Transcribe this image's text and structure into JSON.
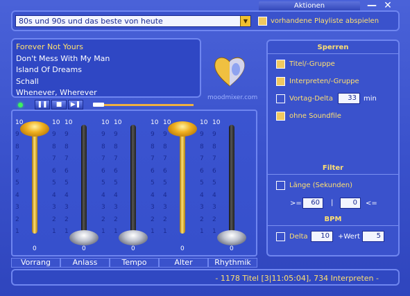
{
  "header": {
    "menu_label": "Aktionen",
    "minimize_label": "—",
    "close_label": "✕"
  },
  "playlist_selector": {
    "value": "80s und 90s und das beste von heute",
    "checkbox_label": "vorhandene Playliste abspielen"
  },
  "tracks": [
    "Forever Not Yours",
    "Don't Mess With My Man",
    "Island Of Dreams",
    "Schall",
    "Whenever, Wherever"
  ],
  "logo_text": "moodmixer.com",
  "transport": {
    "play_label": "▶",
    "pause_label": "❚❚",
    "stop_label": "■",
    "next_label": "▶❚"
  },
  "sliders": {
    "scale": [
      "10",
      "9",
      "8",
      "7",
      "6",
      "5",
      "4",
      "3",
      "2",
      "1"
    ],
    "channels": [
      {
        "name": "Vorrang",
        "value": "0",
        "level": 1.0
      },
      {
        "name": "Anlass",
        "value": "0",
        "level": 0.0
      },
      {
        "name": "Tempo",
        "value": "0",
        "level": 0.0
      },
      {
        "name": "Alter",
        "value": "0",
        "level": 1.0
      },
      {
        "name": "Rhythmik",
        "value": "0",
        "level": 0.0
      }
    ]
  },
  "sperren": {
    "title": "Sperren",
    "titel_gruppe": "Titel/-Gruppe",
    "interpreten_gruppe": "Interpreten/-Gruppe",
    "vortag_delta": "Vortag-Delta",
    "vortag_value": "33",
    "vortag_unit": "min",
    "ohne_soundfile": "ohne Soundfile"
  },
  "filter": {
    "title": "Filter",
    "laenge_label": "Länge (Sekunden)",
    "ge_label": ">=",
    "ge_value": "60",
    "sep": "|",
    "le_value": "0",
    "le_label": "<="
  },
  "bpm": {
    "title": "BPM",
    "delta_label": "Delta",
    "delta_value": "10",
    "wert_label": "+Wert",
    "wert_value": "5"
  },
  "status": "- 1178 Titel [3|11:05:04], 734 Interpreten -"
}
